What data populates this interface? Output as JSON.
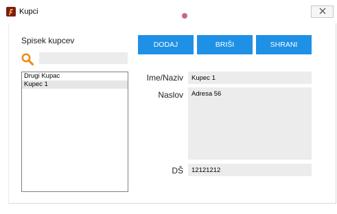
{
  "window": {
    "title": "Kupci"
  },
  "icons": {
    "app": "app-logo-icon",
    "close": "close-icon",
    "search": "search-icon"
  },
  "colors": {
    "accent": "#1e90e6",
    "field_bg": "#ececec",
    "search_icon": "#ef8b1a"
  },
  "clients": {
    "title": "Spisek kupcev",
    "search": {
      "value": "",
      "placeholder": ""
    },
    "items": [
      {
        "label": "Drugi Kupac"
      },
      {
        "label": "Kupec 1"
      }
    ],
    "selected_index": 1
  },
  "toolbar": {
    "add_label": "DODAJ",
    "delete_label": "BRIŠI",
    "save_label": "SHRANI"
  },
  "form": {
    "name": {
      "label": "Ime/Naziv",
      "value": "Kupec 1"
    },
    "address": {
      "label": "Naslov",
      "value": "Adresa 56"
    },
    "ds": {
      "label": "DŠ",
      "value": "12121212"
    }
  }
}
